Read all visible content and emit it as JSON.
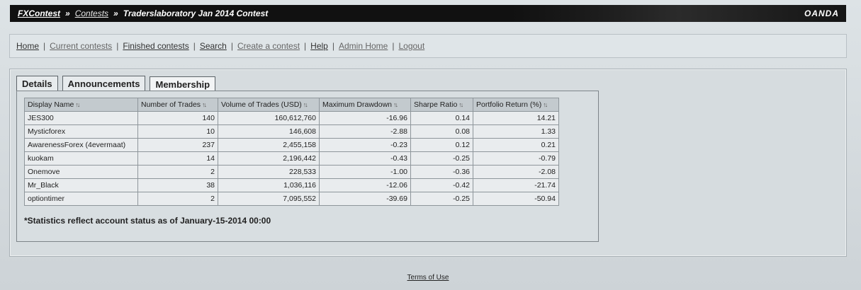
{
  "breadcrumb": {
    "root": "FXContest",
    "contests": "Contests",
    "separator": "»",
    "current": "Traderslaboratory Jan 2014 Contest"
  },
  "brand": "OANDA",
  "nav": {
    "items": [
      {
        "label": "Home",
        "name": "nav-home"
      },
      {
        "label": "Current contests",
        "name": "nav-current-contests"
      },
      {
        "label": "Finished contests",
        "name": "nav-finished-contests"
      },
      {
        "label": "Search",
        "name": "nav-search"
      },
      {
        "label": "Create a contest",
        "name": "nav-create-contest"
      },
      {
        "label": "Help",
        "name": "nav-help"
      },
      {
        "label": "Admin Home",
        "name": "nav-admin-home"
      },
      {
        "label": "Logout",
        "name": "nav-logout"
      }
    ],
    "separator": "|"
  },
  "tabs": [
    "Details",
    "Announcements",
    "Membership"
  ],
  "active_tab": "Membership",
  "table": {
    "headers": [
      "Display Name",
      "Number of Trades",
      "Volume of Trades (USD)",
      "Maximum Drawdown",
      "Sharpe Ratio",
      "Portfolio Return (%)"
    ],
    "rows": [
      [
        "JES300",
        "140",
        "160,612,760",
        "-16.96",
        "0.14",
        "14.21"
      ],
      [
        "Mysticforex",
        "10",
        "146,608",
        "-2.88",
        "0.08",
        "1.33"
      ],
      [
        "AwarenessForex (4evermaat)",
        "237",
        "2,455,158",
        "-0.23",
        "0.12",
        "0.21"
      ],
      [
        "kuokam",
        "14",
        "2,196,442",
        "-0.43",
        "-0.25",
        "-0.79"
      ],
      [
        "Onemove",
        "2",
        "228,533",
        "-1.00",
        "-0.36",
        "-2.08"
      ],
      [
        "Mr_Black",
        "38",
        "1,036,116",
        "-12.06",
        "-0.42",
        "-21.74"
      ],
      [
        "optiontimer",
        "2",
        "7,095,552",
        "-39.69",
        "-0.25",
        "-50.94"
      ]
    ]
  },
  "note": "*Statistics reflect account status as of January-15-2014 00:00",
  "footer": {
    "terms": "Terms of Use"
  },
  "icons": {
    "sort": "sort-arrows-icon"
  }
}
